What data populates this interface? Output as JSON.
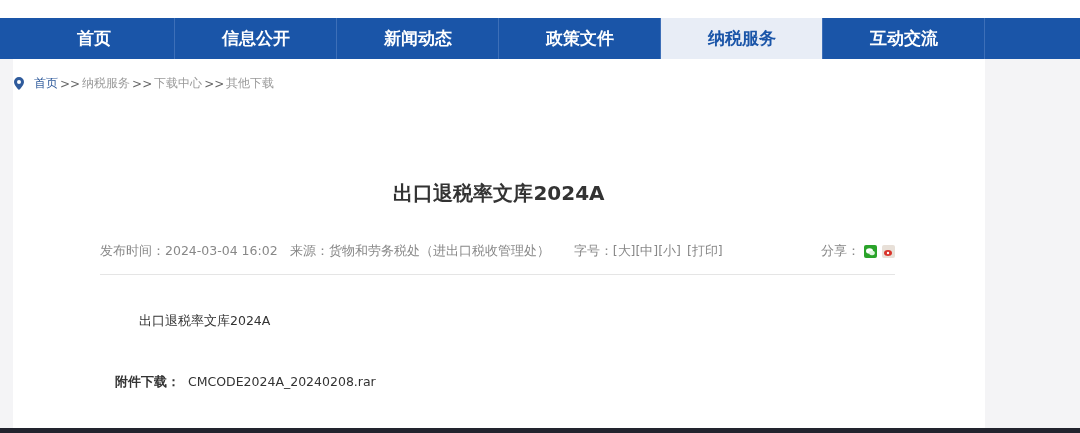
{
  "nav": {
    "tabs": [
      {
        "label": "首页",
        "selected": false
      },
      {
        "label": "信息公开",
        "selected": false
      },
      {
        "label": "新闻动态",
        "selected": false
      },
      {
        "label": "政策文件",
        "selected": false
      },
      {
        "label": "纳税服务",
        "selected": true
      },
      {
        "label": "互动交流",
        "selected": false
      }
    ]
  },
  "breadcrumb": {
    "separator": ">>",
    "items": [
      {
        "label": "首页",
        "kind": "home"
      },
      {
        "label": "纳税服务",
        "kind": "link"
      },
      {
        "label": "下载中心",
        "kind": "link"
      },
      {
        "label": "其他下载",
        "kind": "link"
      }
    ]
  },
  "article": {
    "title": "出口退税率文库2024A",
    "meta": {
      "published": "发布时间：2024-03-04 16:02",
      "source": "来源：货物和劳务税处（进出口税收管理处）",
      "font_size_label": "字号：",
      "font_sizes": [
        "[大]",
        "[中]",
        "[小]"
      ],
      "print": "[打印]",
      "share_label": "分享："
    },
    "body": "出口退税率文库2024A",
    "attachment": {
      "label": "附件下载：",
      "file": "CMCODE2024A_20240208.rar"
    }
  }
}
